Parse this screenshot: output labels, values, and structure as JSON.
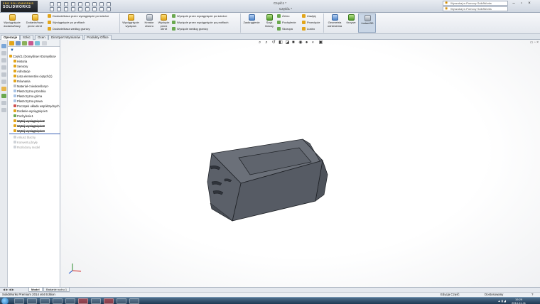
{
  "app": {
    "logo_top": "3DS SOLIDWORKS",
    "logo_main": "SOLIDWORKS",
    "doc_title": "Część1 *",
    "doc_title_2": "Część1 *"
  },
  "search": {
    "field1": "Wyszukaj w Pomocy SolidWorks",
    "field2": "Wyszukaj w Pomocy SolidWorks"
  },
  "ribbon": {
    "extrude_boss": "Wyciągnięcie dodania/bazy",
    "revolve_boss": "Dodanie/baza przez obrót",
    "sweep_boss": "Dodanie/baza przez wyciągnięcie po ścieżce",
    "loft_boss": "Wyciągnięcie po profilach",
    "boundary_boss": "Dodanie/baza według granicy",
    "extrude_cut": "Wyciągnięcie wycięcia",
    "hole_wizard": "Kreator otworu",
    "revolve_cut": "Wycięcie przez obrót",
    "sweep_cut": "Wycięcie przez wyciągnięcie po ścieżce",
    "loft_cut": "Wycięcie przez wyciągnięcie po profilach",
    "boundary_cut": "Wycięcie według granicy",
    "fillet": "Zaokrąglenie",
    "linear_pattern": "Szyk liniowy",
    "rib": "Żebro",
    "draft": "Pochylenie",
    "shell": "Skorupa",
    "wrap": "Zawijaj",
    "intersect": "Przecięcie",
    "mirror": "Lustro",
    "ref_geometry": "Geometria odniesienia",
    "curves": "Krzywe",
    "instant3d": "Instant3D"
  },
  "tabs": {
    "features": "Operacje",
    "sketch": "Szkic",
    "evaluate": "Ocen",
    "dimxpert": "DimXpert Wymiarów",
    "office": "Produkty Office"
  },
  "tree": {
    "part": "Część1 (Domyślna<<Domyślna>",
    "history": "Historia",
    "sensors": "Sensory",
    "annotations": "Adnotacje",
    "weldments": "Lista elementów ciętych(1)",
    "equations": "Równania",
    "material": "Materiał <nieokreślony>",
    "front_plane": "Płaszczyzna przednia",
    "top_plane": "Płaszczyzna górna",
    "right_plane": "Płaszczyzna prawa",
    "origin": "Początek układu współrzędnych",
    "boss_extrude1": "Dodanie-wyciągnięcie1",
    "draft1": "Pochylenie1",
    "cut_extrude2": "Wytnij-wyciągnięcie2",
    "cut_extrude3": "Wytnij-wyciągnięcie3",
    "cut_extrude4": "Wytnij-wyciągnięcie4",
    "sheet_metal": "Arkusz blachy",
    "flat_pattern": "Konwertuj bryłę",
    "base_model": "Rozłożony model"
  },
  "bottom_tabs": {
    "model": "Model",
    "motion_study": "Badanie ruchu 1"
  },
  "status": {
    "edition": "SolidWorks Premium 2014 x64 Edition",
    "mode": "Edycja Część",
    "units": "Dostosowany"
  },
  "taskbar": {
    "time": "19:29",
    "date": "2014-11-11"
  },
  "colors": {
    "model_face": "#5d626b",
    "model_top": "#6a6f78",
    "model_side": "#4b5058",
    "model_edge": "#1e2126",
    "ribbon_accent": "#e2a51a"
  }
}
